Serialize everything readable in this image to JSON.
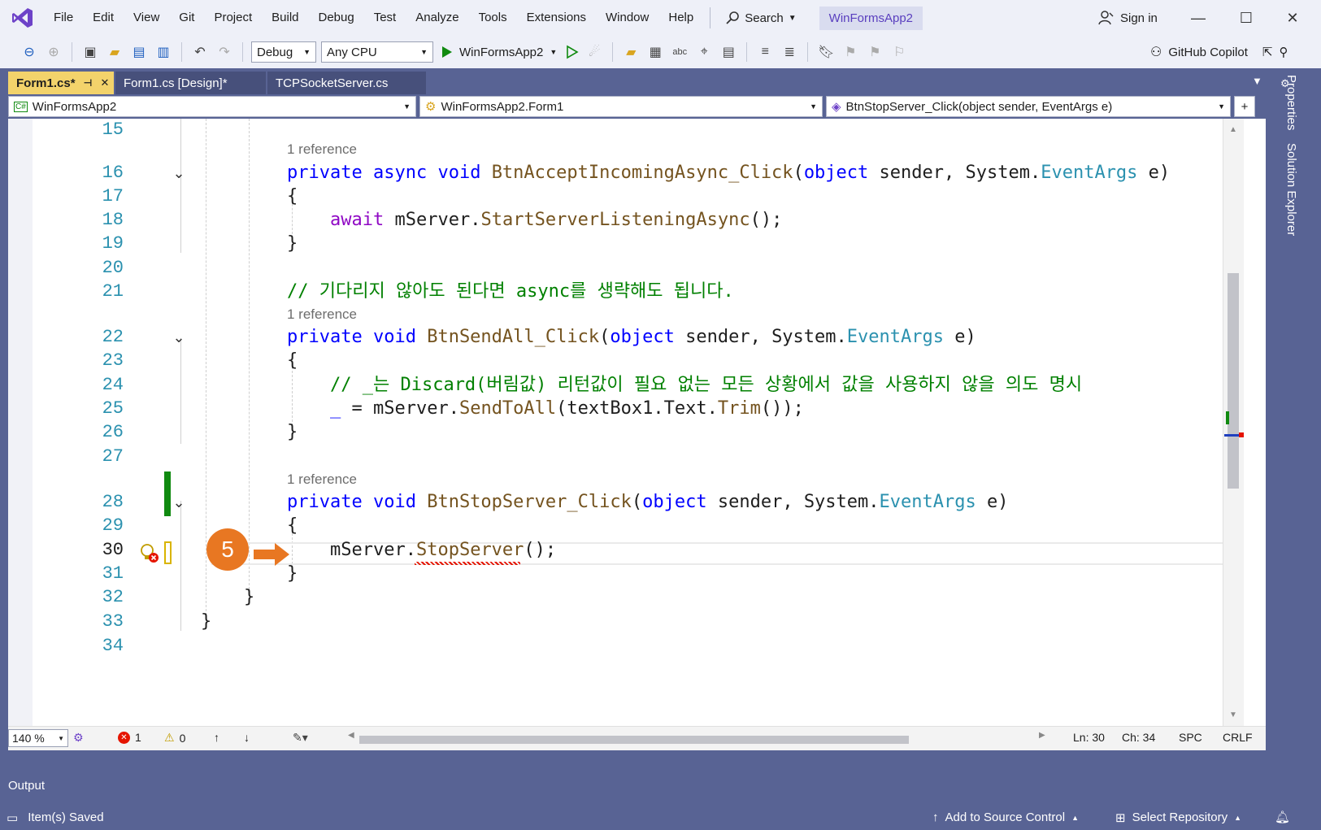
{
  "menu": {
    "items": [
      "File",
      "Edit",
      "View",
      "Git",
      "Project",
      "Build",
      "Debug",
      "Test",
      "Analyze",
      "Tools",
      "Extensions",
      "Window",
      "Help"
    ],
    "search_label": "Search",
    "solution_name": "WinFormsApp2",
    "sign_in": "Sign in"
  },
  "toolbar": {
    "configuration": "Debug",
    "platform": "Any CPU",
    "start_target": "WinFormsApp2",
    "copilot": "GitHub Copilot"
  },
  "tabs": [
    {
      "label": "Form1.cs*",
      "active": true
    },
    {
      "label": "Form1.cs [Design]*",
      "active": false
    },
    {
      "label": "TCPSocketServer.cs",
      "active": false
    }
  ],
  "navbar": {
    "project": "WinFormsApp2",
    "type": "WinFormsApp2.Form1",
    "member": "BtnStopServer_Click(object sender, EventArgs e)"
  },
  "code": {
    "lens_ref": "1 reference",
    "line_numbers": [
      "15",
      "16",
      "17",
      "18",
      "19",
      "20",
      "21",
      "22",
      "23",
      "24",
      "25",
      "26",
      "27",
      "28",
      "29",
      "30",
      "31",
      "32",
      "33",
      "34"
    ],
    "l16": {
      "kw1": "private",
      "kw2": "async",
      "kw3": "void",
      "fn": "BtnAcceptIncomingAsync_Click",
      "p1": "(",
      "kw4": "object",
      "p2": " sender, System.",
      "ty": "EventArgs",
      "p3": " e)"
    },
    "l17": "{",
    "l18": {
      "kw": "await",
      "rest1": " mServer.",
      "fn": "StartServerListeningAsync",
      "rest2": "();"
    },
    "l19": "}",
    "l21": "// 기다리지 않아도 된다면 async를 생략해도 됩니다.",
    "l22": {
      "kw1": "private",
      "kw2": "void",
      "fn": "BtnSendAll_Click",
      "p1": "(",
      "kw3": "object",
      "p2": " sender, System.",
      "ty": "EventArgs",
      "p3": " e)"
    },
    "l23": "{",
    "l24": "// _는 Discard(버림값) 리턴값이 필요 없는 모든 상황에서 값을 사용하지 않을 의도 명시",
    "l25": {
      "a": "_",
      "b": " = mServer.",
      "fn": "SendToAll",
      "c": "(textBox1.Text.",
      "fn2": "Trim",
      "d": "());"
    },
    "l26": "}",
    "l28": {
      "kw1": "private",
      "kw2": "void",
      "fn": "BtnStopServer_Click",
      "p1": "(",
      "kw3": "object",
      "p2": " sender, System.",
      "ty": "EventArgs",
      "p3": " e)"
    },
    "l29": "{",
    "l30": {
      "a": "mServer.",
      "fn": "StopServer",
      "b": "();"
    },
    "l31": "}",
    "l32": "}",
    "l33": "}"
  },
  "step_badge": "5",
  "editor_status": {
    "zoom": "140 %",
    "errors": "1",
    "warnings": "0",
    "ln": "Ln: 30",
    "ch": "Ch: 34",
    "indent": "SPC",
    "eol": "CRLF"
  },
  "side_tabs": [
    "Properties",
    "Solution Explorer"
  ],
  "output_label": "Output",
  "statusbar": {
    "message": "Item(s) Saved",
    "source_control": "Add to Source Control",
    "repository": "Select Repository"
  },
  "colors": {
    "chrome": "#586394",
    "active_tab": "#f3d36b",
    "badge": "#e87722",
    "keyword": "#0000ff",
    "comment": "#008000",
    "type": "#2b91af"
  }
}
